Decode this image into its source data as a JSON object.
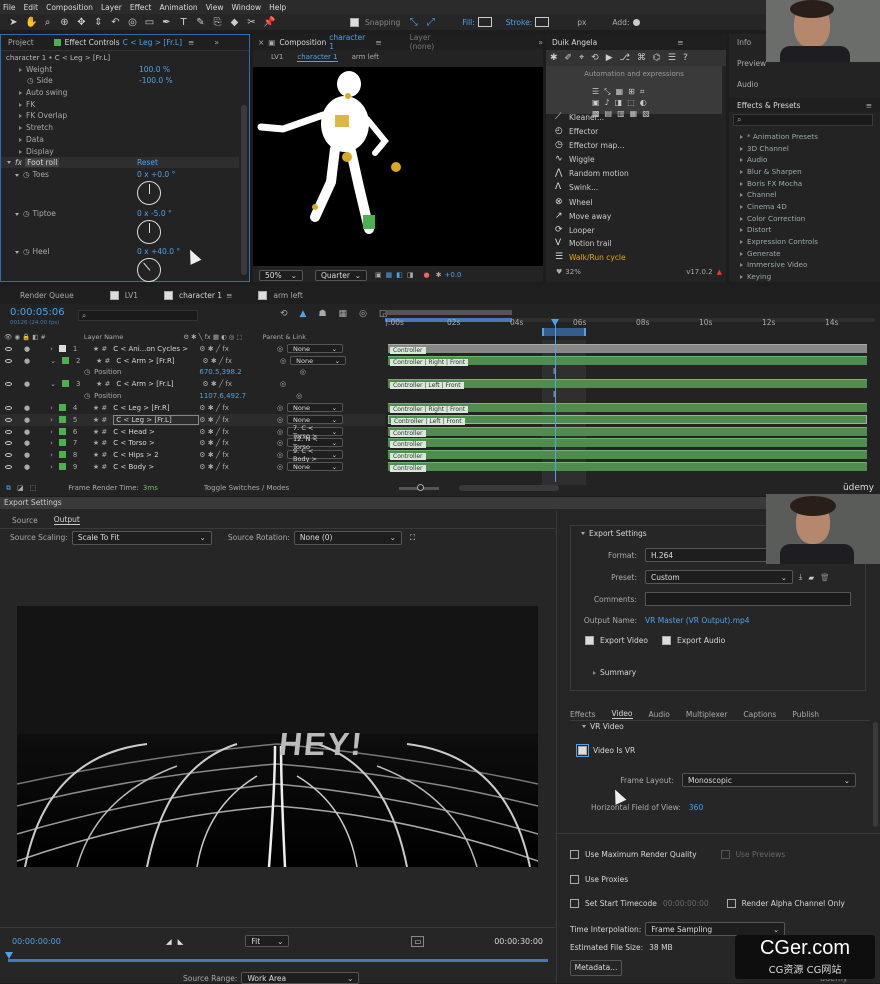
{
  "menu": [
    "File",
    "Edit",
    "Composition",
    "Layer",
    "Effect",
    "Animation",
    "View",
    "Window",
    "Help"
  ],
  "toolbar": {
    "snapping": "Snapping",
    "fill": "Fill:",
    "stroke": "Stroke:",
    "px": "px",
    "add": "Add:"
  },
  "effect_controls": {
    "tab_project": "Project",
    "tab_title": "Effect Controls",
    "tab_target": "C < Leg > [Fr.L]",
    "header": "character 1 • C < Leg > [Fr.L]",
    "props": [
      {
        "label": "Weight",
        "value": "100.0 %"
      },
      {
        "label": "Side",
        "value": "-100.0 %"
      },
      {
        "label": "Auto swing",
        "value": ""
      },
      {
        "label": "FK",
        "value": ""
      },
      {
        "label": "FK Overlap",
        "value": ""
      },
      {
        "label": "Stretch",
        "value": ""
      },
      {
        "label": "Data",
        "value": ""
      },
      {
        "label": "Display",
        "value": ""
      }
    ],
    "foot_roll": "Foot roll",
    "reset": "Reset",
    "toes": {
      "label": "Toes",
      "value": "0 x +0.0 °"
    },
    "tiptoe": {
      "label": "Tiptoe",
      "value": "0 x -5.0 °"
    },
    "heel": {
      "label": "Heel",
      "value": "0 x +40.0 °"
    }
  },
  "composition": {
    "tab": "Composition",
    "name": "character 1",
    "layer_tab": "Layer (none)",
    "crumbs": [
      "LV1",
      "character 1",
      "arm left"
    ],
    "zoom": "50%",
    "quality": "Quarter",
    "exposure": "+0.0"
  },
  "duik": {
    "title": "Duik Angela",
    "subtitle": "Automation and expressions",
    "version": "v17.0.2",
    "items": [
      "Kleaner...",
      "Effector",
      "Effector map...",
      "Wiggle",
      "Random motion",
      "Swink...",
      "Wheel",
      "Move away",
      "Looper",
      "Motion trail",
      "Walk/Run cycle"
    ],
    "hearts": "32%"
  },
  "right_panel": {
    "info": "Info",
    "preview": "Preview",
    "audio": "Audio",
    "effects_presets": "Effects & Presets",
    "categories": [
      "* Animation Presets",
      "3D Channel",
      "Audio",
      "Blur & Sharpen",
      "Boris FX Mocha",
      "Channel",
      "Cinema 4D",
      "Color Correction",
      "Distort",
      "Expression Controls",
      "Generate",
      "Immersive Video",
      "Keying"
    ]
  },
  "timeline": {
    "tabs": [
      "Render Queue",
      "LV1",
      "character 1",
      "arm left"
    ],
    "timecode": "0:00:05:06",
    "subcode": "00126 (24.00 fps)",
    "col_layer": "Layer Name",
    "col_parent": "Parent & Link",
    "ruler": [
      "):00s",
      "02s",
      "04s",
      "06s",
      "08s",
      "10s",
      "12s",
      "14s"
    ],
    "layers": [
      {
        "num": "1",
        "name": "C < Ani...on Cycles >",
        "parent": "None",
        "bar": "Controller"
      },
      {
        "num": "2",
        "name": "C < Arm > [Fr.R]",
        "parent": "None",
        "bar": "Controller | Right | Front"
      },
      {
        "num": "",
        "name": "Position",
        "value": "670.5,398.2",
        "sub": true
      },
      {
        "num": "3",
        "name": "C < Arm > [Fr.L]",
        "parent": "",
        "bar": "Controller | Left | Front"
      },
      {
        "num": "",
        "name": "Position",
        "value": "1107.6,492.7",
        "sub": true
      },
      {
        "num": "4",
        "name": "C < Leg > [Fr.R]",
        "parent": "None",
        "bar": "Controller | Right | Front"
      },
      {
        "num": "5",
        "name": "C < Leg > [Fr.L]",
        "parent": "None",
        "bar": "Controller | Left | Front"
      },
      {
        "num": "6",
        "name": "C < Head >",
        "parent": "7. C < Torso >",
        "bar": "Controller"
      },
      {
        "num": "7",
        "name": "C < Torso >",
        "parent": "12. N < Torso",
        "bar": "Controller"
      },
      {
        "num": "8",
        "name": "C < Hips > 2",
        "parent": "9. C < Body >",
        "bar": "Controller"
      },
      {
        "num": "9",
        "name": "C < Body >",
        "parent": "None",
        "bar": "Controller"
      }
    ],
    "render_time_label": "Frame Render Time:",
    "render_time": "3ms",
    "toggle": "Toggle Switches / Modes",
    "brand": "ūdemy"
  },
  "export": {
    "title": "Export Settings",
    "tabs": [
      "Source",
      "Output"
    ],
    "source_scaling_label": "Source Scaling:",
    "source_scaling": "Scale To Fit",
    "source_rotation_label": "Source Rotation:",
    "source_rotation": "None (0)",
    "preview_text": "HEY!",
    "time_start": "00:00:00:00",
    "time_end": "00:00:30:00",
    "fit": "Fit",
    "source_range_label": "Source Range:",
    "source_range": "Work Area",
    "settings_header": "Export Settings",
    "format_label": "Format:",
    "format": "H.264",
    "preset_label": "Preset:",
    "preset": "Custom",
    "comments_label": "Comments:",
    "output_name_label": "Output Name:",
    "output_name": "VR Master (VR Output).mp4",
    "export_video": "Export Video",
    "export_audio": "Export Audio",
    "summary": "Summary",
    "tabs2": [
      "Effects",
      "Video",
      "Audio",
      "Multiplexer",
      "Captions",
      "Publish"
    ],
    "vr_header": "VR Video",
    "video_is_vr": "Video Is VR",
    "frame_layout_label": "Frame Layout:",
    "frame_layout": "Monoscopic",
    "hfov_label": "Horizontal Field of View:",
    "hfov": "360",
    "max_quality": "Use Maximum Render Quality",
    "use_previews": "Use Previews",
    "use_proxies": "Use Proxies",
    "set_start": "Set Start Timecode",
    "start_tc": "00:00:00:00",
    "alpha": "Render Alpha Channel Only",
    "interp_label": "Time Interpolation:",
    "interp": "Frame Sampling",
    "filesize_label": "Estimated File Size:",
    "filesize": "38 MB",
    "metadata": "Metadata...",
    "brand": "ūdemy"
  },
  "watermark": {
    "main": "CGer.com",
    "sub": "CG资源  CG网站"
  }
}
